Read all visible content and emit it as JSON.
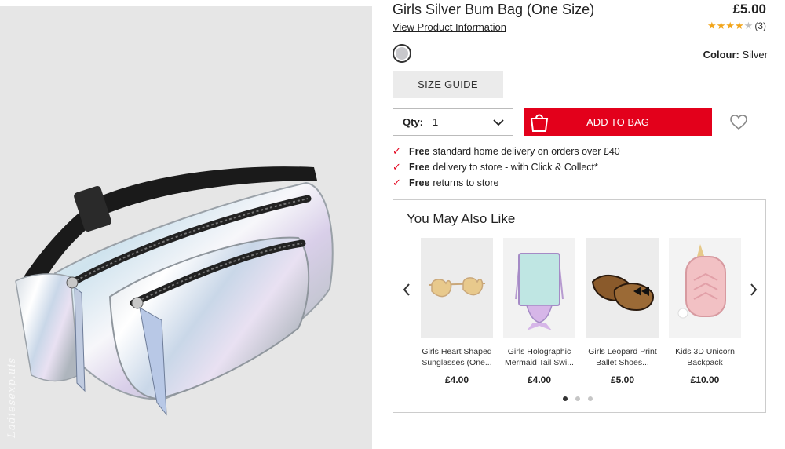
{
  "product": {
    "title": "Girls Silver Bum Bag (One Size)",
    "price": "£5.00",
    "view_info_label": "View Product Information",
    "rating": {
      "stars": 4,
      "max": 5,
      "review_count": "(3)"
    },
    "colour_label": "Colour:",
    "colour_value": "Silver",
    "swatch_color": "#c8c8cc",
    "watermark": "Ladiesexp.uis"
  },
  "actions": {
    "size_guide_label": "SIZE GUIDE",
    "qty_label": "Qty:",
    "qty_value": "1",
    "add_to_bag_label": "ADD TO BAG",
    "accent_color": "#e3001b"
  },
  "delivery": [
    {
      "bold": "Free",
      "text": "standard home delivery on orders over £40"
    },
    {
      "bold": "Free",
      "text": "delivery to store - with Click & Collect*"
    },
    {
      "bold": "Free",
      "text": "returns to store"
    }
  ],
  "recommendations": {
    "title": "You May Also Like",
    "items": [
      {
        "name": "Girls Heart Shaped Sunglasses (One...",
        "price": "£4.00",
        "icon": "sunglasses"
      },
      {
        "name": "Girls Holographic Mermaid Tail Swi...",
        "price": "£4.00",
        "icon": "drawstring-bag"
      },
      {
        "name": "Girls Leopard Print Ballet Shoes...",
        "price": "£5.00",
        "icon": "ballet-shoes"
      },
      {
        "name": "Kids 3D Unicorn Backpack",
        "price": "£10.00",
        "icon": "unicorn-backpack"
      }
    ],
    "pages": 3,
    "active_page": 1
  }
}
